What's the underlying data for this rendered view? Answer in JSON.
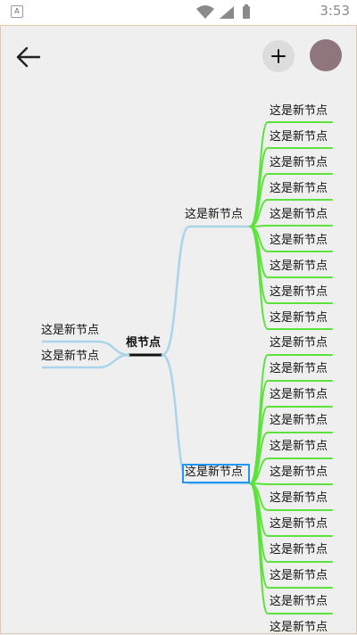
{
  "status_bar": {
    "time": "3:53"
  },
  "toolbar": {
    "back_icon": "arrow-left-icon",
    "add_icon": "plus-icon"
  },
  "mindmap": {
    "root": "根节点",
    "left_children": [
      "这是新节点",
      "这是新节点"
    ],
    "right_children": [
      {
        "label": "这是新节点",
        "children": [
          "这是新节点",
          "这是新节点",
          "这是新节点",
          "这是新节点",
          "这是新节点",
          "这是新节点",
          "这是新节点",
          "这是新节点",
          "这是新节点"
        ]
      },
      {
        "label": "这是新节点",
        "selected": true,
        "children": [
          "这是新节点",
          "这是新节点",
          "这是新节点",
          "这是新节点",
          "这是新节点",
          "这是新节点",
          "这是新节点",
          "这是新节点",
          "这是新节点",
          "这是新节点",
          "这是新节点"
        ]
      }
    ],
    "standalone": "这是新节点"
  },
  "colors": {
    "branch_level1": "#a9d5ea",
    "branch_level2": "#5be33b",
    "selection": "#2196f3"
  }
}
